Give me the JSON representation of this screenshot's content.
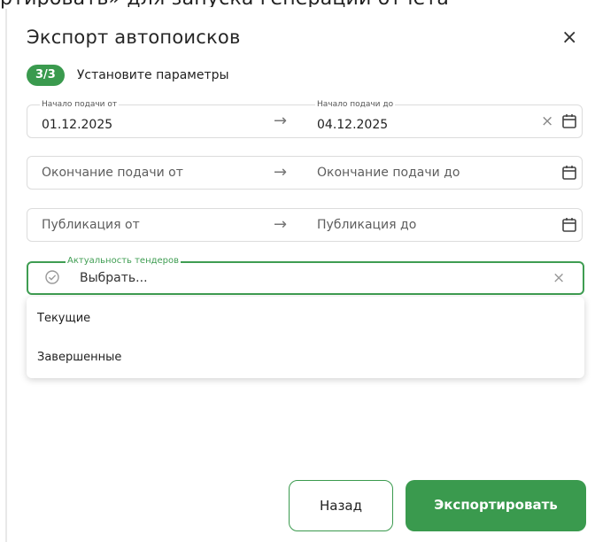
{
  "background": {
    "text": "ртировать» для запуска генерации отчета"
  },
  "modal": {
    "title": "Экспорт автопоисков",
    "close_icon": "close-icon",
    "step": {
      "badge": "3/3",
      "label": "Установите параметры"
    },
    "submission_start": {
      "from_label": "Начало подачи от",
      "from_value": "01.12.2025",
      "to_label": "Начало подачи до",
      "to_value": "04.12.2025"
    },
    "submission_end": {
      "from_placeholder": "Окончание подачи от",
      "to_placeholder": "Окончание подачи до"
    },
    "publication": {
      "from_placeholder": "Публикация от",
      "to_placeholder": "Публикация до"
    },
    "relevance": {
      "label": "Актуальность тендеров",
      "placeholder": "Выбрать...",
      "options": [
        "Текущие",
        "Завершенные"
      ]
    },
    "buttons": {
      "back": "Назад",
      "export": "Экспортировать"
    }
  },
  "colors": {
    "accent": "#3a9a4e",
    "border": "#dcdcdc"
  }
}
